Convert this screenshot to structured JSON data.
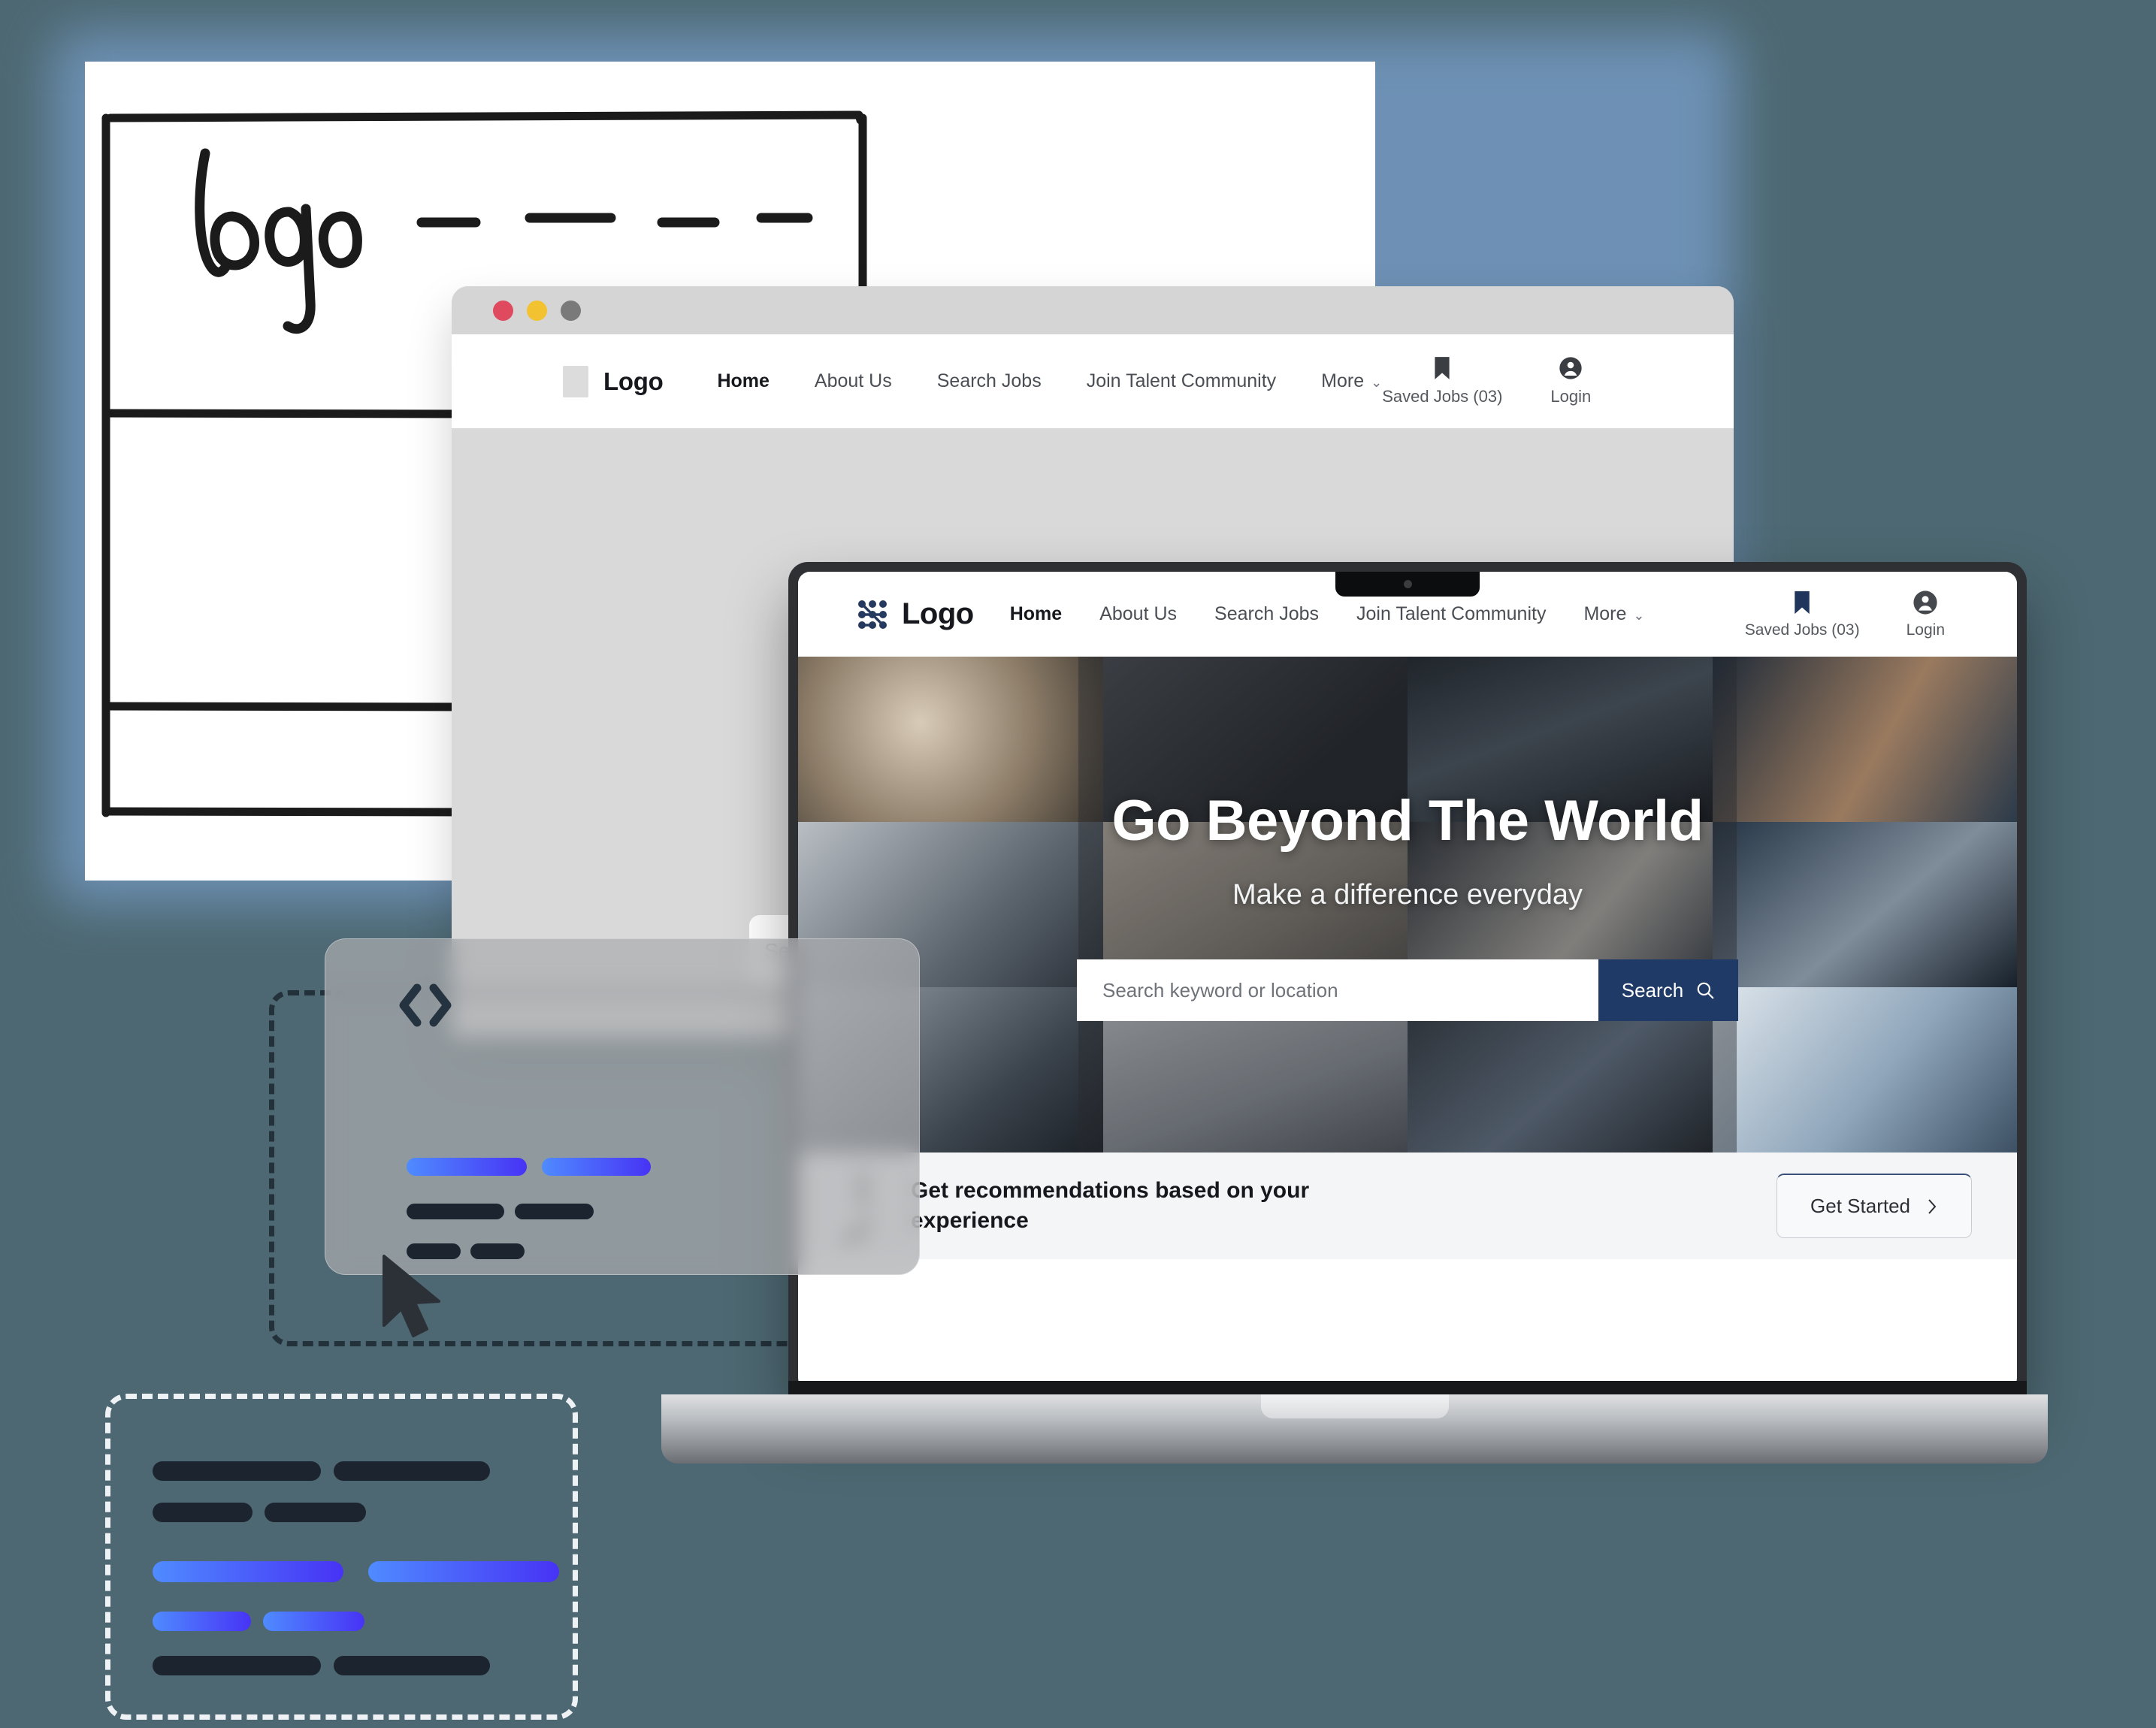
{
  "canvas": {
    "background_color": "#4d6872",
    "glow_color": "#6f93b8"
  },
  "sketch_card": {
    "label": "logo",
    "name": "hand-drawn-wireframe"
  },
  "browser_window": {
    "traffic_lights": [
      "close",
      "minimize",
      "maximize"
    ],
    "traffic_colors": [
      "#e04a5f",
      "#f2c230",
      "#7a7a7a"
    ],
    "logo_text": "Logo",
    "nav": [
      {
        "label": "Home",
        "active": true
      },
      {
        "label": "About Us",
        "active": false
      },
      {
        "label": "Search Jobs",
        "active": false
      },
      {
        "label": "Join Talent Community",
        "active": false
      },
      {
        "label": "More",
        "active": false,
        "has_chevron": true
      }
    ],
    "actions": [
      {
        "icon": "bookmark-icon",
        "label": "Saved Jobs (03)"
      },
      {
        "icon": "user-account-icon",
        "label": "Login"
      }
    ],
    "ghost_search_text": "Se"
  },
  "laptop": {
    "site": {
      "logo_text": "Logo",
      "nav": [
        {
          "label": "Home",
          "active": true
        },
        {
          "label": "About Us",
          "active": false
        },
        {
          "label": "Search Jobs",
          "active": false
        },
        {
          "label": "Join Talent Community",
          "active": false
        },
        {
          "label": "More",
          "active": false,
          "has_chevron": true
        }
      ],
      "actions": [
        {
          "icon": "bookmark-icon",
          "label": "Saved Jobs (03)"
        },
        {
          "icon": "user-account-icon",
          "label": "Login"
        }
      ],
      "hero": {
        "title": "Go Beyond The World",
        "subtitle": "Make a difference everyday",
        "search_placeholder": "Search keyword or location",
        "search_value": "",
        "search_button": "Search",
        "search_icon": "magnifier-icon",
        "accent_color": "#1f3a66"
      },
      "recommendation_bar": {
        "text": "Get recommendations based on your experience",
        "cta_label": "Get Started",
        "cta_icon": "chevron-right-icon"
      }
    }
  },
  "code_card": {
    "icon": "code-brackets-icon",
    "cursor": "arrow-pointer-icon",
    "gradient_from": "#4f8bff",
    "gradient_to": "#4733f5",
    "dark_bar_color": "#1c2430",
    "rows": [
      {
        "type": "blue",
        "bars": [
          160,
          145
        ]
      },
      {
        "type": "dark",
        "bars": [
          130,
          105
        ]
      },
      {
        "type": "dark",
        "bars": [
          72,
          72
        ]
      }
    ]
  },
  "code_box": {
    "border_style": "dashed",
    "border_color": "#eef2f4",
    "gradient_from": "#4f8bff",
    "gradient_to": "#4733f5",
    "dark_bar_color": "#1c2430",
    "rows": [
      {
        "type": "dark",
        "bars": [
          224,
          208
        ]
      },
      {
        "type": "dark",
        "bars": [
          133,
          135
        ]
      },
      {
        "type": "blue",
        "bars": [
          254,
          254
        ]
      },
      {
        "type": "blue",
        "bars": [
          131,
          135
        ]
      },
      {
        "type": "dark",
        "bars": [
          224,
          208
        ]
      }
    ]
  }
}
